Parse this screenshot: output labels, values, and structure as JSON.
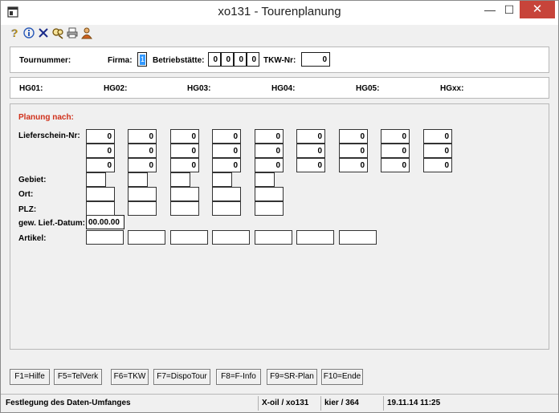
{
  "window": {
    "title": "xo131 - Tourenplanung",
    "min": "—",
    "max": "☐",
    "close": "✕"
  },
  "toolbar": {
    "icons": [
      "help-icon",
      "info-icon",
      "delete-icon",
      "search-icon",
      "print-icon",
      "user-icon"
    ]
  },
  "header": {
    "tournummer_label": "Tournummer:",
    "firma_label": "Firma:",
    "firma_value": "1",
    "betriebsstaette_label": "Betriebstätte:",
    "betriebsstaette_values": [
      "0",
      "0",
      "0",
      "0"
    ],
    "tkw_label": "TKW-Nr:",
    "tkw_value": "0"
  },
  "hg": {
    "labels": [
      "HG01:",
      "HG02:",
      "HG03:",
      "HG04:",
      "HG05:",
      "HGxx:"
    ]
  },
  "planung": {
    "title": "Planung nach:",
    "lieferschein_label": "Lieferschein-Nr:",
    "lieferschein_rows": [
      [
        "0",
        "0",
        "0",
        "0",
        "0",
        "0",
        "0",
        "0",
        "0"
      ],
      [
        "0",
        "0",
        "0",
        "0",
        "0",
        "0",
        "0",
        "0",
        "0"
      ],
      [
        "0",
        "0",
        "0",
        "0",
        "0",
        "0",
        "0",
        "0",
        "0"
      ]
    ],
    "gebiet_label": "Gebiet:",
    "ort_label": "Ort:",
    "plz_label": "PLZ:",
    "datum_label": "gew. Lief.-Datum:",
    "datum_value": "00.00.00",
    "artikel_label": "Artikel:"
  },
  "fkeys": [
    "F1=Hilfe",
    "F5=TelVerk",
    "F6=TKW",
    "F7=DispoTour",
    "F8=F-Info",
    "F9=SR-Plan",
    "F10=Ende"
  ],
  "status": {
    "message": "Festlegung des Daten-Umfanges",
    "program": "X-oil / xo131",
    "user": "kier / 364",
    "datetime": "19.11.14 11:25"
  }
}
